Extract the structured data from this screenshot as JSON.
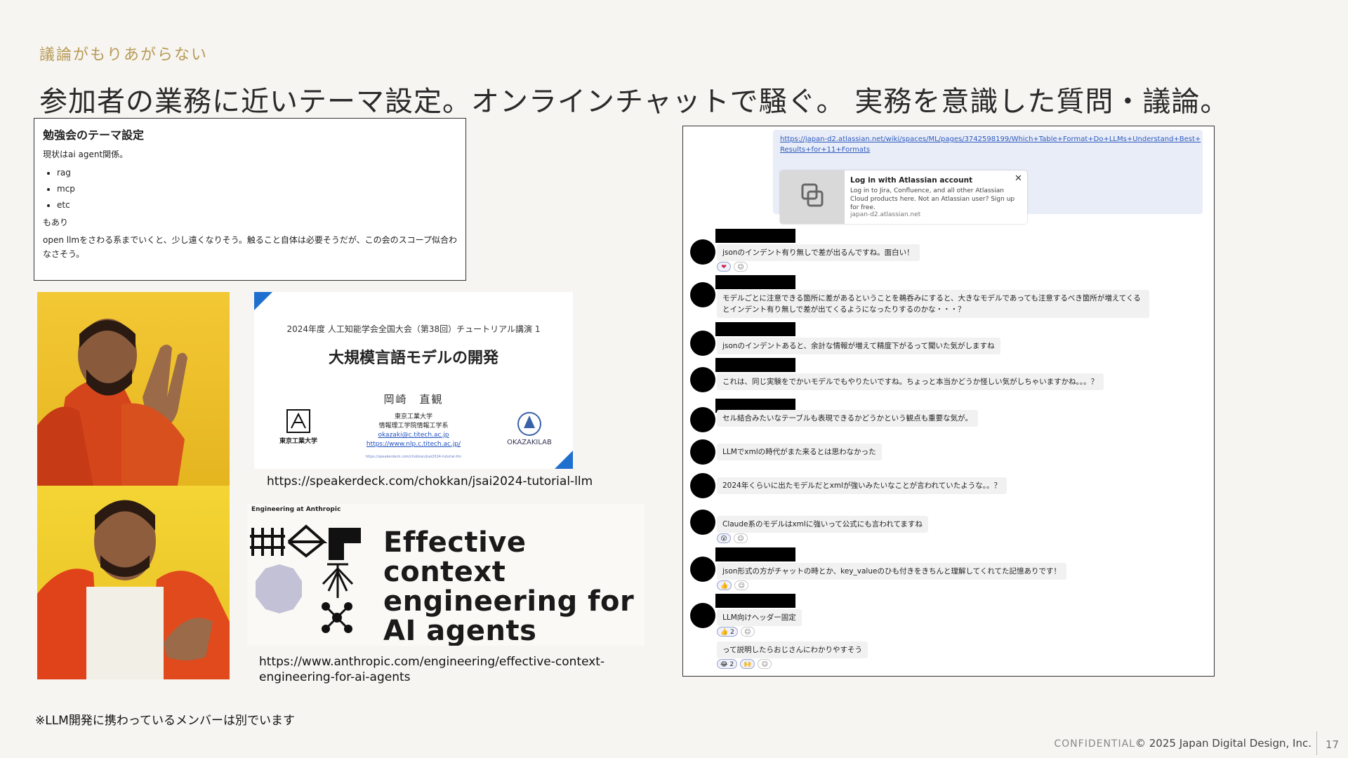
{
  "slide": {
    "subtitle": "議論がもりあがらない",
    "title": "参加者の業務に近いテーマ設定。オンラインチャットで騒ぐ。 実務を意識した質問・議論。",
    "note": "※LLM開発に携わっているメンバーは別でいます",
    "footer_confidential": "CONFIDENTIAL",
    "footer_copyright": "© 2025 Japan Digital Design, Inc.",
    "page_number": "17"
  },
  "theme_box": {
    "heading": "勉強会のテーマ設定",
    "intro": "現状はai agent関係。",
    "items": [
      "rag",
      "mcp",
      "etc"
    ],
    "also": "もあり",
    "body": "open llmをさわる系までいくと、少し遠くなりそう。触ること自体は必要そうだが、この会のスコープ似合わなさそう。"
  },
  "slide_card": {
    "conference": "2024年度 人工知能学会全国大会（第38回）チュートリアル講演 1",
    "title": "大規模言語モデルの開発",
    "author": "岡崎　直観",
    "aff_line1": "東京工業大学",
    "aff_line2": "情報理工学院情報工学系",
    "email": "okazaki@c.titech.ac.jp",
    "web": "https://www.nlp.c.titech.ac.jp/",
    "tiny_url": "https://speakerdeck.com/chokkan/jsai2024-tutorial-llm",
    "left_logo": "東京工業大学",
    "right_logo": "OKAZAKILAB",
    "url": "https://speakerdeck.com/chokkan/jsai2024-tutorial-llm"
  },
  "anthropic_card": {
    "eyebrow": "Engineering at Anthropic",
    "title": "Effective context engineering for AI agents",
    "url": "https://www.anthropic.com/engineering/effective-context-engineering-for-ai-agents"
  },
  "chat": {
    "link": "https://japan-d2.atlassian.net/wiki/spaces/ML/pages/3742598199/Which+Table+Format+Do+LLMs+Understand+Best+Results+for+11+Formats",
    "unfurl_title": "Log in with Atlassian account",
    "unfurl_desc": "Log in to Jira, Confluence, and all other Atlassian Cloud products here. Not an Atlassian user? Sign up for free.",
    "unfurl_domain": "japan-d2.atlassian.net",
    "messages": [
      "jsonのインデント有り無しで差が出るんですね。面白い！",
      "モデルごとに注意できる箇所に差があるということを鵜呑みにすると、大きなモデルであっても注意するべき箇所が増えてくるとインデント有り無しで差が出てくるようになったりするのかな・・・？",
      "jsonのインデントあると、余計な情報が増えて精度下がるって聞いた気がしますね",
      "これは、同じ実験をでかいモデルでもやりたいですね。ちょっと本当かどうか怪しい気がしちゃいますかね。。。？",
      "セル結合みたいなテーブルも表現できるかどうかという観点も重要な気が。",
      "LLMでxmlの時代がまた来るとは思わなかった",
      "2024年くらいに出たモデルだとxmlが強いみたいなことが言われていたような。。？",
      "Claude系のモデルはxmlに強いって公式にも言われてますね",
      "json形式の方がチャットの時とか、key_valueのひも付きをきちんと理解してくれてた記憶ありです！",
      "LLM向けヘッダー固定",
      "って説明したらおじさんにわかりやすそう"
    ],
    "reactions": {
      "r1": [
        "❤",
        "☺"
      ],
      "r8": [
        "😮",
        "☺"
      ],
      "r9": [
        "👍",
        "☺"
      ],
      "r10": [
        "👍 2",
        "☺"
      ],
      "r11": [
        "😂 2",
        "🙌",
        "☺"
      ]
    }
  }
}
